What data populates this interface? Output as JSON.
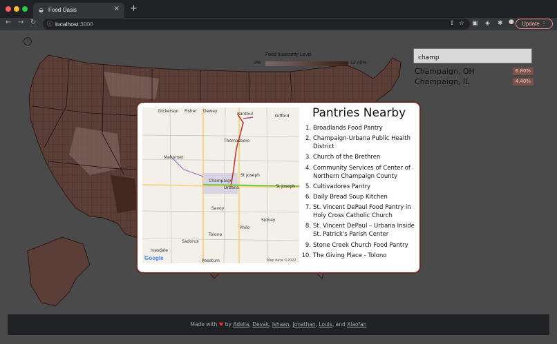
{
  "browser": {
    "tab_title": "Food Oasis",
    "url_host": "localhost",
    "url_port": ":3000",
    "update_label": "Update"
  },
  "legend": {
    "title": "Food Insecurity Level",
    "min": "0%",
    "max": "12.40%"
  },
  "search": {
    "value": "champ",
    "results": [
      {
        "name": "Champaign, OH",
        "value": "6.80%"
      },
      {
        "name": "Champaign, IL",
        "value": "4.40%"
      }
    ]
  },
  "map": {
    "labels": {
      "dickerson": "Dickerson",
      "fisher": "Fisher",
      "dewey": "Dewey",
      "rantoul": "Rantoul",
      "gifford": "Gifford",
      "thomasboro": "Thomasboro",
      "mahomet": "Mahomet",
      "champaign": "Champaign",
      "urbana": "Urbana",
      "sidney": "Sidney",
      "stjoseph": "St Joseph",
      "savoy": "Savoy",
      "philo": "Philo",
      "tolono": "Tolono",
      "sadorus": "Sadorus",
      "ivesdale": "Ivesdale",
      "pesotum": "Pesotum",
      "google": "Google",
      "attribution": "Map data ©2022"
    }
  },
  "panel": {
    "title": "Pantries Nearby",
    "pantries": [
      {
        "num": "1.",
        "name": "Broadlands Food Pantry"
      },
      {
        "num": "2.",
        "name": "Champaign-Urbana Public Health District"
      },
      {
        "num": "3.",
        "name": "Church of the Brethren"
      },
      {
        "num": "4.",
        "name": "Community Services of Center of Northern Champaign County"
      },
      {
        "num": "5.",
        "name": "Cultivadores Pantry"
      },
      {
        "num": "6.",
        "name": "Daily Bread Soup Kitchen"
      },
      {
        "num": "7.",
        "name": "St. Vincent DePaul Food Pantry in Holy Cross Catholic Church"
      },
      {
        "num": "8.",
        "name": "St. Vincent DePaul – Urbana Inside St. Patrick's Parish Center"
      },
      {
        "num": "9.",
        "name": "Stone Creek Church Food Pantry"
      },
      {
        "num": "10.",
        "name": "The Giving Place - Tolono"
      }
    ]
  },
  "footer": {
    "made_with": "Made with",
    "by": "by",
    "authors": [
      "Adelia",
      "Devak",
      "Ishaan",
      "Jonathan",
      "Louis",
      "Xiaofan"
    ],
    "sep": ",",
    "and": "and"
  }
}
